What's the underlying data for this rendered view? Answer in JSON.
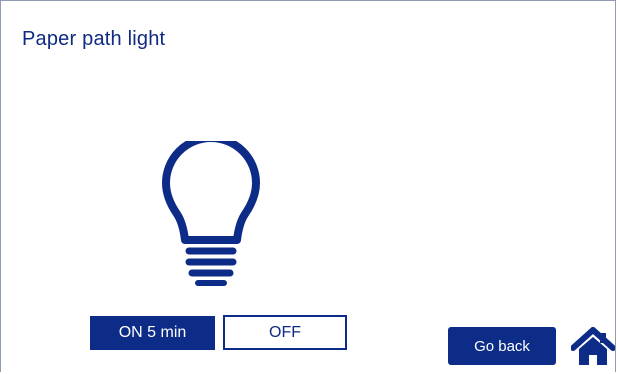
{
  "header": {
    "title": "Paper path light"
  },
  "icons": {
    "bulb": "lightbulb-icon",
    "home": "home-icon"
  },
  "controls": {
    "on_label": "ON 5 min",
    "off_label": "OFF",
    "back_label": "Go back"
  },
  "colors": {
    "accent": "#0d2c87",
    "text": "#0f2a80",
    "background": "#ffffff"
  }
}
